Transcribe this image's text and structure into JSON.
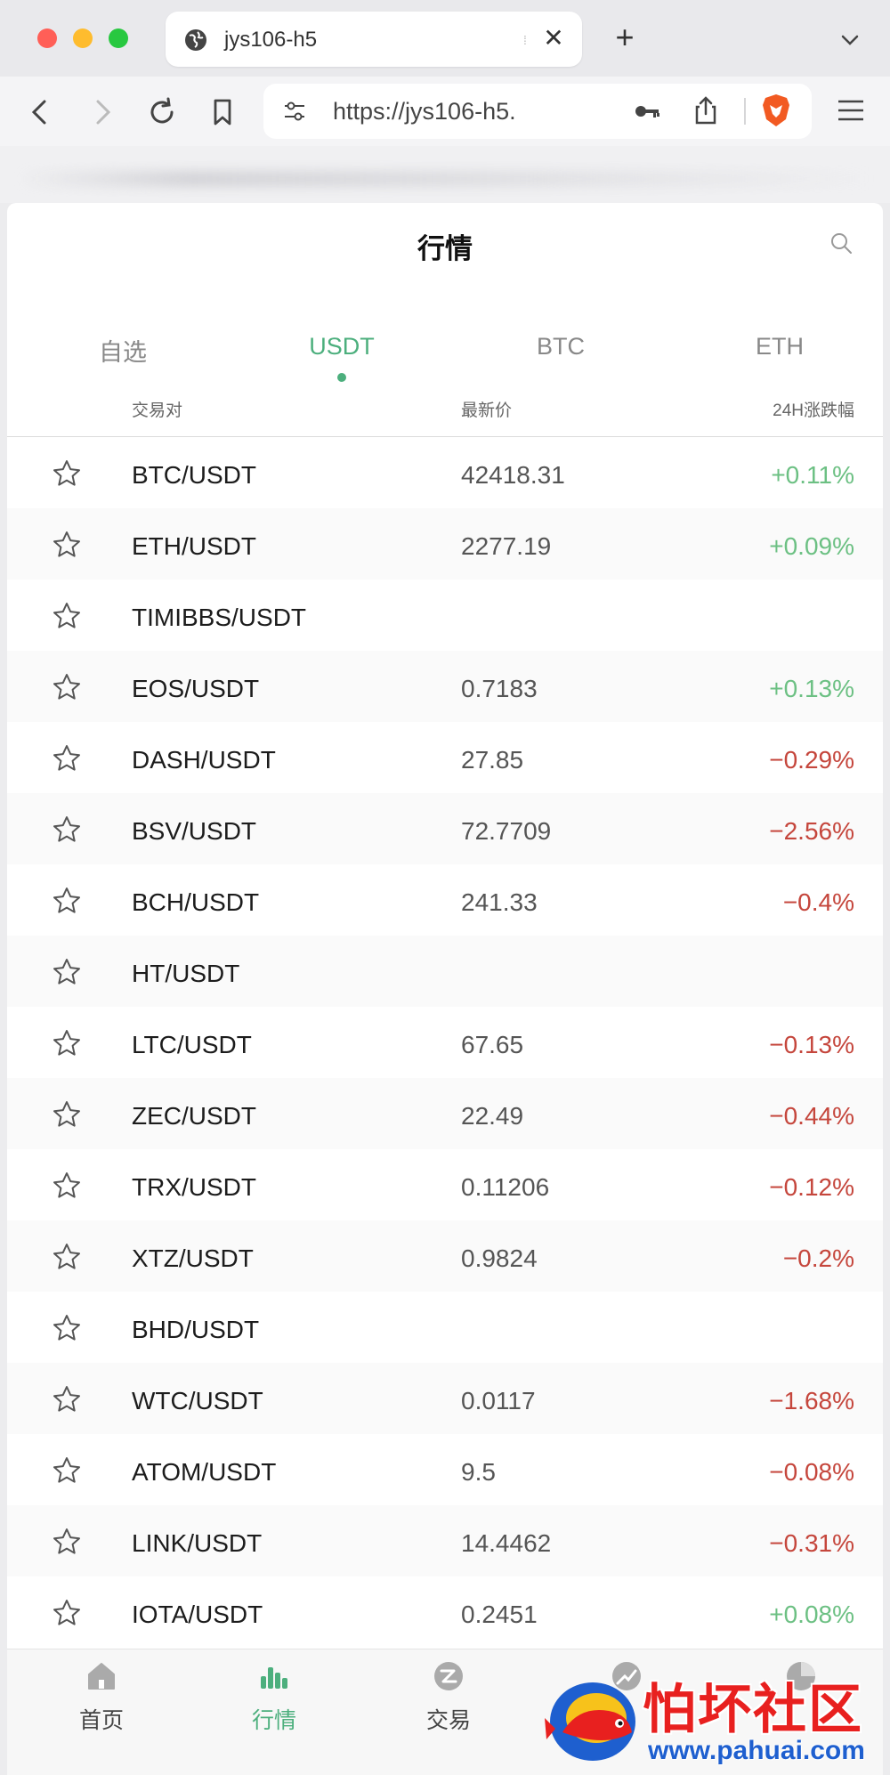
{
  "browser": {
    "tab_title": "jys106-h5",
    "tab_close": "✕",
    "new_tab": "+",
    "url": "https://jys106-h5."
  },
  "page": {
    "title": "行情"
  },
  "market_tabs": [
    {
      "label": "自选",
      "active": false
    },
    {
      "label": "USDT",
      "active": true
    },
    {
      "label": "BTC",
      "active": false
    },
    {
      "label": "ETH",
      "active": false
    }
  ],
  "columns": {
    "pair": "交易对",
    "price": "最新价",
    "change": "24H涨跌幅"
  },
  "rows": [
    {
      "pair": "BTC/USDT",
      "price": "42418.31",
      "change": "+0.11%",
      "direction": "up"
    },
    {
      "pair": "ETH/USDT",
      "price": "2277.19",
      "change": "+0.09%",
      "direction": "up"
    },
    {
      "pair": "TIMIBBS/USDT",
      "price": "",
      "change": "",
      "direction": ""
    },
    {
      "pair": "EOS/USDT",
      "price": "0.7183",
      "change": "+0.13%",
      "direction": "up"
    },
    {
      "pair": "DASH/USDT",
      "price": "27.85",
      "change": "−0.29%",
      "direction": "down"
    },
    {
      "pair": "BSV/USDT",
      "price": "72.7709",
      "change": "−2.56%",
      "direction": "down"
    },
    {
      "pair": "BCH/USDT",
      "price": "241.33",
      "change": "−0.4%",
      "direction": "down"
    },
    {
      "pair": "HT/USDT",
      "price": "",
      "change": "",
      "direction": ""
    },
    {
      "pair": "LTC/USDT",
      "price": "67.65",
      "change": "−0.13%",
      "direction": "down"
    },
    {
      "pair": "ZEC/USDT",
      "price": "22.49",
      "change": "−0.44%",
      "direction": "down"
    },
    {
      "pair": "TRX/USDT",
      "price": "0.11206",
      "change": "−0.12%",
      "direction": "down"
    },
    {
      "pair": "XTZ/USDT",
      "price": "0.9824",
      "change": "−0.2%",
      "direction": "down"
    },
    {
      "pair": "BHD/USDT",
      "price": "",
      "change": "",
      "direction": ""
    },
    {
      "pair": "WTC/USDT",
      "price": "0.0117",
      "change": "−1.68%",
      "direction": "down"
    },
    {
      "pair": "ATOM/USDT",
      "price": "9.5",
      "change": "−0.08%",
      "direction": "down"
    },
    {
      "pair": "LINK/USDT",
      "price": "14.4462",
      "change": "−0.31%",
      "direction": "down"
    },
    {
      "pair": "IOTA/USDT",
      "price": "0.2451",
      "change": "+0.08%",
      "direction": "up"
    }
  ],
  "bottom_nav": [
    {
      "label": "首页",
      "icon": "home-icon",
      "active": false
    },
    {
      "label": "行情",
      "icon": "chart-bars-icon",
      "active": true
    },
    {
      "label": "交易",
      "icon": "trade-icon",
      "active": false
    },
    {
      "label": "",
      "icon": "trend-icon",
      "active": false
    },
    {
      "label": "",
      "icon": "pie-icon",
      "active": false
    }
  ],
  "watermark": {
    "text": "怕坏社区",
    "url": "www.pahuai.com"
  },
  "colors": {
    "accent": "#4caf7d",
    "up": "#6cc083",
    "down": "#c5463c"
  }
}
